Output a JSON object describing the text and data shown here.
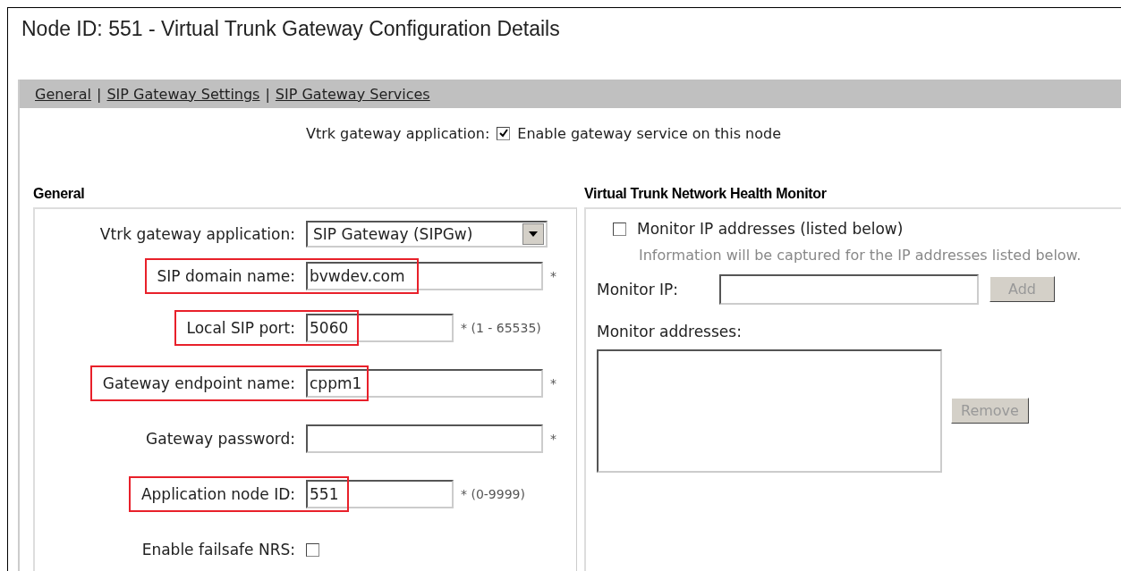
{
  "title": "Node ID: 551 - Virtual Trunk Gateway Configuration Details",
  "nav_links": [
    {
      "label": "General"
    },
    {
      "label": "SIP Gateway Settings"
    },
    {
      "label": "SIP Gateway Services"
    }
  ],
  "nav_separator": "|",
  "gateway_toggle": {
    "label": "Vtrk gateway application:",
    "option": "Enable gateway service on this node",
    "checked": true
  },
  "general": {
    "heading": "General",
    "fields": [
      {
        "kind": "select",
        "label": "Vtrk gateway application:",
        "value": "SIP Gateway (SIPGw)",
        "highlighted": false
      },
      {
        "kind": "text",
        "label": "SIP domain name:",
        "value": "bvwdev.com",
        "note": "*",
        "highlighted": true
      },
      {
        "kind": "number",
        "label": "Local SIP port:",
        "value": "5060",
        "note": "* (1 - 65535)",
        "highlighted": true
      },
      {
        "kind": "text",
        "label": "Gateway endpoint name:",
        "value": "cppm1",
        "note": "*",
        "highlighted": true
      },
      {
        "kind": "text",
        "label": "Gateway password:",
        "note": "*",
        "highlighted": false
      },
      {
        "kind": "number",
        "label": "Application node ID:",
        "value": "551",
        "note": "* (0-9999)",
        "highlighted": true
      },
      {
        "kind": "checkbox",
        "label": "Enable failsafe NRS:",
        "checked": false,
        "highlighted": false
      }
    ]
  },
  "health_monitor": {
    "heading": "Virtual Trunk Network Health Monitor",
    "monitor_option": {
      "label": "Monitor IP addresses (listed below)",
      "checked": false
    },
    "info": "Information will be captured for the IP addresses listed below.",
    "monitor_ip": {
      "label": "Monitor IP:",
      "button": "Add",
      "disabled": true
    },
    "addresses": {
      "label": "Monitor addresses:",
      "button": "Remove",
      "disabled": true
    }
  }
}
